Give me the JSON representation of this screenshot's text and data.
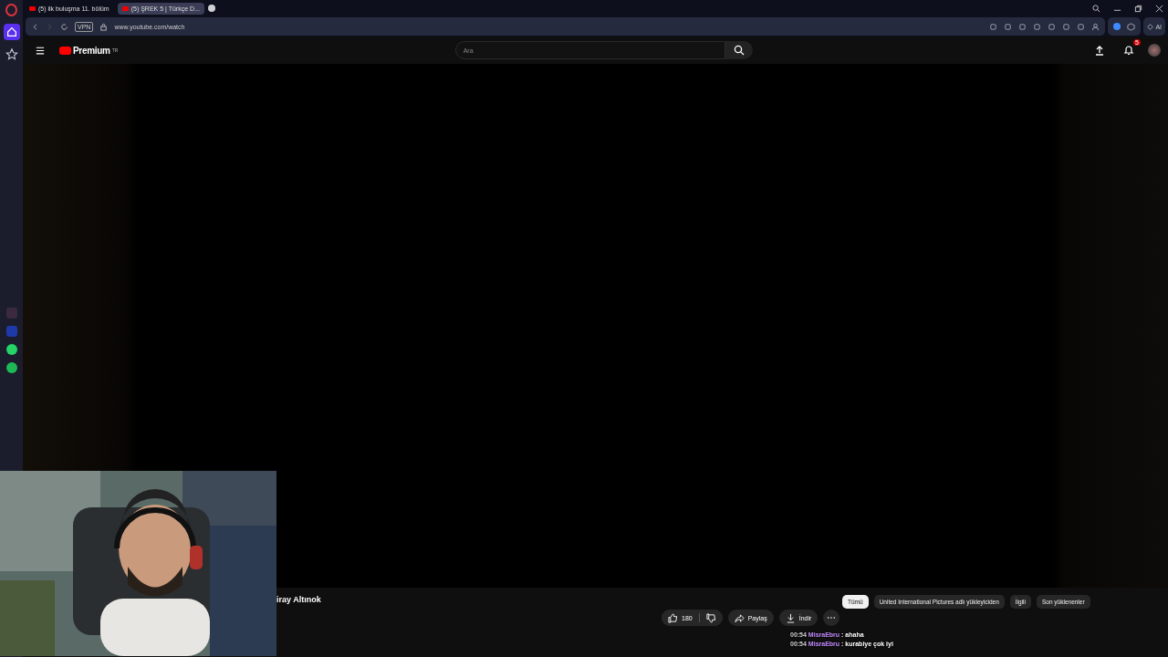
{
  "browser": {
    "tabs": [
      {
        "title": "(5) ilk buluşma 11. bölüm",
        "selected": false
      },
      {
        "title": "(5) ŞREK 5 | Türkçe D...",
        "selected": true
      }
    ],
    "url": "www.youtube.com/watch",
    "vpn": "VPN",
    "ai": "AI"
  },
  "youtube": {
    "logo": "Premium",
    "region": "TR",
    "search": {
      "placeholder": "Ara"
    },
    "notifications": "5",
    "channel_name": "iray Altınok",
    "actions": [
      {
        "kind": "like",
        "label": "180"
      },
      {
        "kind": "share",
        "label": "Paylaş"
      },
      {
        "kind": "download",
        "label": "İndir"
      },
      {
        "kind": "more"
      }
    ],
    "chips": [
      {
        "label": "Tümü",
        "selected": true
      },
      {
        "label": "United International Pictures adlı yükleyiciden",
        "selected": false
      },
      {
        "label": "İlgili",
        "selected": false
      },
      {
        "label": "Son yüklenenler",
        "selected": false
      }
    ]
  },
  "chat": [
    {
      "time": "00:54",
      "user": "MisraEbru",
      "message": ": ahaha"
    },
    {
      "time": "00:54",
      "user": "MisraEbru",
      "message": ": kurabiye çok iyi"
    }
  ]
}
